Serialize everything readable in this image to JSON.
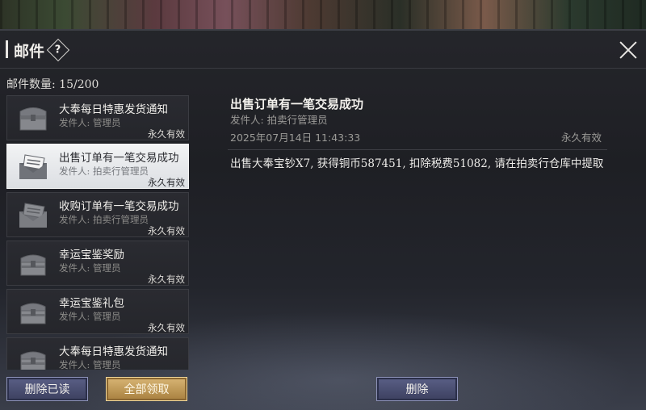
{
  "window": {
    "title": "邮件",
    "help_icon": "?",
    "close_icon": "close-icon"
  },
  "mailbox": {
    "count_label": "邮件数量: 15/200"
  },
  "mails": [
    {
      "subject": "大奉每日特惠发货通知",
      "sender": "发件人: 管理员",
      "expire": "永久有效",
      "icon": "chest-icon",
      "selected": false
    },
    {
      "subject": "出售订单有一笔交易成功",
      "sender": "发件人: 拍卖行管理员",
      "expire": "永久有效",
      "icon": "envelope-open-icon",
      "selected": true
    },
    {
      "subject": "收购订单有一笔交易成功",
      "sender": "发件人: 拍卖行管理员",
      "expire": "永久有效",
      "icon": "envelope-open-icon",
      "selected": false
    },
    {
      "subject": "幸运宝鉴奖励",
      "sender": "发件人: 管理员",
      "expire": "永久有效",
      "icon": "chest-icon",
      "selected": false
    },
    {
      "subject": "幸运宝鉴礼包",
      "sender": "发件人: 管理员",
      "expire": "永久有效",
      "icon": "chest-icon",
      "selected": false
    },
    {
      "subject": "大奉每日特惠发货通知",
      "sender": "发件人: 管理员",
      "expire": "永久有效",
      "icon": "chest-icon",
      "selected": false
    }
  ],
  "detail": {
    "title": "出售订单有一笔交易成功",
    "sender": "发件人: 拍卖行管理员",
    "date": "2025年07月14日 11:43:33",
    "expire": "永久有效",
    "body": "出售大奉宝钞X7, 获得铜币587451, 扣除税费51082, 请在拍卖行仓库中提取"
  },
  "buttons": {
    "delete_read": "删除已读",
    "claim_all": "全部领取",
    "delete": "删除"
  }
}
